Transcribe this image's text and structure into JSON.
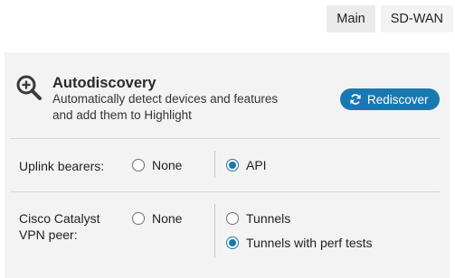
{
  "tabs": [
    {
      "label": "Main",
      "active": false
    },
    {
      "label": "SD-WAN",
      "active": true
    }
  ],
  "autodiscovery": {
    "icon": "magnifier-plus-icon",
    "title": "Autodiscovery",
    "description": "Automatically detect devices and features and add them to Highlight",
    "button_icon": "refresh-icon",
    "button_label": "Rediscover"
  },
  "uplink": {
    "label": "Uplink bearers:",
    "options": [
      {
        "label": "None",
        "selected": false
      },
      {
        "label": "API",
        "selected": true
      }
    ]
  },
  "cisco": {
    "label": "Cisco Catalyst VPN peer:",
    "options": [
      {
        "label": "None",
        "selected": false
      },
      {
        "label": "Tunnels",
        "selected": false
      },
      {
        "label": "Tunnels with perf tests",
        "selected": true
      }
    ]
  },
  "colors": {
    "accent": "#1a78b0",
    "panel": "#f3f3f3"
  }
}
